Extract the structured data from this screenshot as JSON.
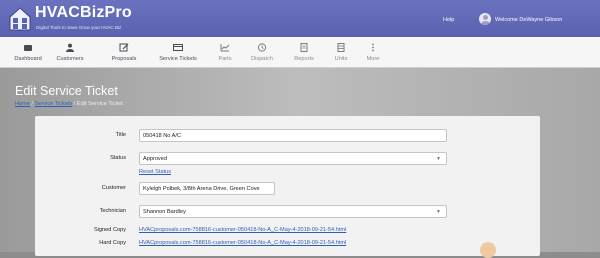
{
  "brand": {
    "name": "HVACBizPro",
    "tagline": "Digital Tools to Save Grow your HVAC Biz"
  },
  "header": {
    "help": "Help",
    "welcome": "Welcome DeWayne Gibson"
  },
  "nav": [
    {
      "label": "Dashboard",
      "icon": "dashboard-icon"
    },
    {
      "label": "Customers",
      "icon": "customers-icon"
    },
    {
      "label": "Proposals",
      "icon": "proposals-icon"
    },
    {
      "label": "Service Tickets",
      "icon": "service-tickets-icon"
    },
    {
      "label": "Parts",
      "icon": "parts-icon"
    },
    {
      "label": "Dispatch",
      "icon": "dispatch-icon"
    },
    {
      "label": "Reports",
      "icon": "reports-icon"
    },
    {
      "label": "Units",
      "icon": "units-icon"
    },
    {
      "label": "More",
      "icon": "more-icon"
    }
  ],
  "page": {
    "title": "Edit Service Ticket",
    "breadcrumb": {
      "home": "Home",
      "sep": "/",
      "service_tickets": "Service Tickets",
      "current": "Edit Service Ticket"
    }
  },
  "form": {
    "title_label": "Title",
    "title_value": "050418 No A/C",
    "status_label": "Status",
    "status_value": "Approved",
    "reset_status": "Reset Status",
    "customer_label": "Customer",
    "customer_value": "Kyleigh Polbek, 3/8th Arena Drive, Green Cove",
    "technician_label": "Technician",
    "technician_value": "Shannon Bardley",
    "signed_copy_label": "Signed Copy",
    "signed_copy_link": "HVACproposals.com-758816-customer-050418-No-A_C-May-4-2018-09-21-54.html",
    "hard_copy_label": "Hard Copy",
    "hard_copy_link": "HVACproposals.com-758816-customer-050418-No-A_C-May-4-2018-09-21-54.html"
  }
}
